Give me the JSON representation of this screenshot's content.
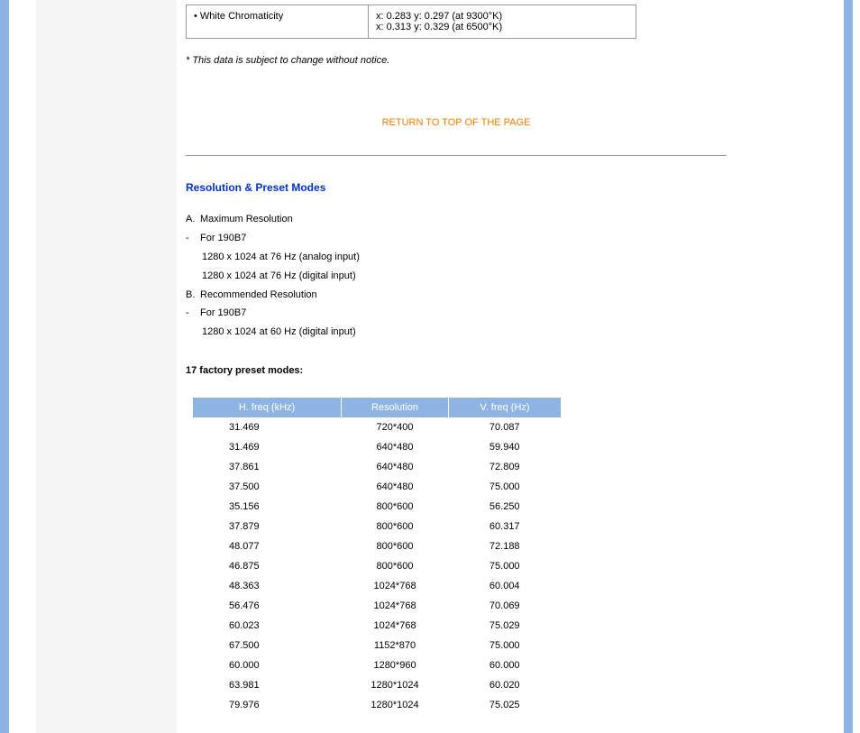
{
  "spec": {
    "label": "• White Chromaticity",
    "value_line1": "x: 0.283 y: 0.297 (at 9300°K)",
    "value_line2": "x: 0.313 y: 0.329 (at 6500°K)"
  },
  "notice": "* This data is subject to change without notice.",
  "return_link": "RETURN TO TOP OF THE PAGE",
  "section_title": "Resolution & Preset Modes",
  "modes": {
    "a_label": "A.",
    "a_text": "Maximum Resolution",
    "a_dash": "-",
    "a_sub1": "For 190B7",
    "a_detail1": "1280 x 1024 at 76 Hz (analog input)",
    "a_detail2": "1280 x 1024 at 76 Hz (digital input)",
    "b_label": "B.",
    "b_text": "Recommended Resolution",
    "b_dash": "-",
    "b_sub1": "For 190B7",
    "b_detail1": "1280 x 1024 at 60 Hz (digital input)"
  },
  "preset_heading": "17 factory preset modes:",
  "preset_headers": {
    "h1": "H. freq (kHz)",
    "h2": "Resolution",
    "h3": "V. freq (Hz)"
  },
  "preset_rows": [
    {
      "h": "31.469",
      "r": "720*400",
      "v": "70.087"
    },
    {
      "h": "31.469",
      "r": "640*480",
      "v": "59.940"
    },
    {
      "h": "37.861",
      "r": "640*480",
      "v": "72.809"
    },
    {
      "h": "37.500",
      "r": "640*480",
      "v": "75.000"
    },
    {
      "h": "35.156",
      "r": "800*600",
      "v": "56.250"
    },
    {
      "h": "37.879",
      "r": "800*600",
      "v": "60.317"
    },
    {
      "h": "48.077",
      "r": "800*600",
      "v": "72.188"
    },
    {
      "h": "46.875",
      "r": "800*600",
      "v": "75.000"
    },
    {
      "h": "48.363",
      "r": "1024*768",
      "v": "60.004"
    },
    {
      "h": "56.476",
      "r": "1024*768",
      "v": "70.069"
    },
    {
      "h": "60.023",
      "r": "1024*768",
      "v": "75.029"
    },
    {
      "h": "67.500",
      "r": "1152*870",
      "v": "75.000"
    },
    {
      "h": "60.000",
      "r": "1280*960",
      "v": "60.000"
    },
    {
      "h": "63.981",
      "r": "1280*1024",
      "v": "60.020"
    },
    {
      "h": "79.976",
      "r": "1280*1024",
      "v": "75.025"
    }
  ]
}
